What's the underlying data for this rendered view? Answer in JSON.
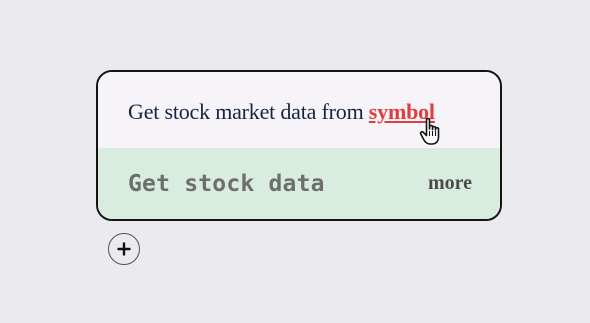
{
  "block": {
    "description_prefix": "Get stock market data from ",
    "link_label": "symbol",
    "action_label": "Get stock data",
    "more_label": "more"
  },
  "icons": {
    "cursor": "hand-pointer-icon",
    "add": "plus-icon"
  },
  "colors": {
    "link": "#e23c3c",
    "footer_bg": "#d8eddf",
    "card_bg": "#f6f4f8",
    "page_bg": "#ebebef"
  }
}
